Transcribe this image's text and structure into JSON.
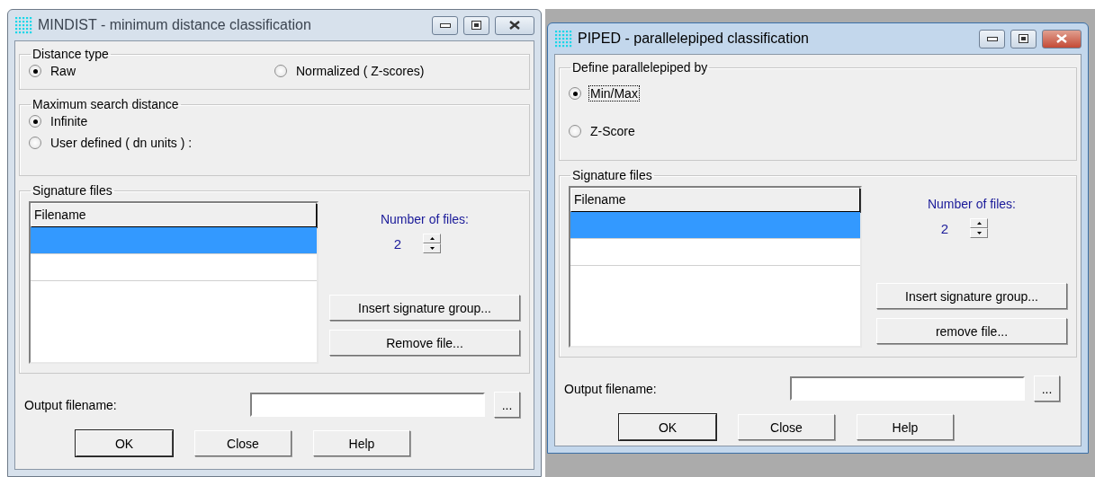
{
  "windows": [
    {
      "title": "MINDIST - minimum distance classification",
      "active": false,
      "radio_groups": [
        {
          "label": "Distance type",
          "options": [
            {
              "label": "Raw",
              "selected": true,
              "focused": false
            },
            {
              "label": "Normalized ( Z-scores)",
              "selected": false,
              "focused": false
            }
          ]
        },
        {
          "label": "Maximum search distance",
          "options": [
            {
              "label": "Infinite",
              "selected": true,
              "focused": false
            },
            {
              "label": "User defined ( dn units ) :",
              "selected": false,
              "focused": false
            }
          ]
        }
      ],
      "signature_files": {
        "label": "Signature files",
        "column": "Filename",
        "rows": [
          {
            "selected": true
          },
          {
            "selected": false
          }
        ],
        "count_label": "Number of files:",
        "count": "2",
        "buttons": [
          "Insert signature group...",
          "Remove file..."
        ]
      },
      "output": {
        "label": "Output filename:",
        "browse": "..."
      },
      "buttons": [
        "OK",
        "Close",
        "Help"
      ]
    },
    {
      "title": "PIPED - parallelepiped classification",
      "active": true,
      "radio_groups": [
        {
          "label": "Define parallelepiped by",
          "options": [
            {
              "label": "Min/Max",
              "selected": true,
              "focused": true
            },
            {
              "label": "Z-Score",
              "selected": false,
              "focused": false
            }
          ]
        }
      ],
      "signature_files": {
        "label": "Signature files",
        "column": "Filename",
        "rows": [
          {
            "selected": true
          },
          {
            "selected": false
          }
        ],
        "count_label": "Number of files:",
        "count": "2",
        "buttons": [
          "Insert signature group...",
          "remove file..."
        ]
      },
      "output": {
        "label": "Output filename:",
        "browse": "..."
      },
      "buttons": [
        "OK",
        "Close",
        "Help"
      ]
    }
  ]
}
